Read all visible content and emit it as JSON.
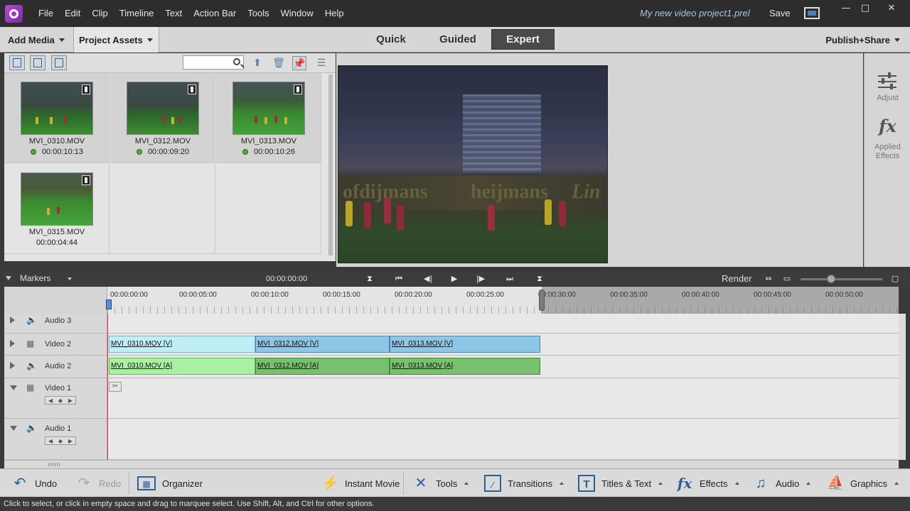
{
  "titlebar": {
    "menu": [
      "File",
      "Edit",
      "Clip",
      "Timeline",
      "Text",
      "Action Bar",
      "Tools",
      "Window",
      "Help"
    ],
    "project_name": "My new video project1.prel",
    "save_label": "Save",
    "min_glyph": "—",
    "max_glyph": "□",
    "close_glyph": "✕"
  },
  "modebar": {
    "add_media": "Add Media",
    "project_assets": "Project Assets",
    "tabs": [
      "Quick",
      "Guided",
      "Expert"
    ],
    "active_tab": "Expert",
    "publish_share": "Publish+Share"
  },
  "assets": {
    "search_placeholder": "",
    "items": [
      {
        "name": "MVI_0310.MOV",
        "duration": "00:00:10:13",
        "used": true
      },
      {
        "name": "MVI_0312.MOV",
        "duration": "00:00:09:20",
        "used": true
      },
      {
        "name": "MVI_0313.MOV",
        "duration": "00:00:10:26",
        "used": true
      },
      {
        "name": "MVI_0315.MOV",
        "duration": "00:00:04:44",
        "used": false
      }
    ]
  },
  "monitor": {
    "brand_1": "ofdijmans",
    "brand_2": "heijmans",
    "brand_3": "Lin"
  },
  "right_panel": {
    "adjust": "Adjust",
    "fx_glyph": "fx",
    "applied_effects_1": "Applied",
    "applied_effects_2": "Effects"
  },
  "timeline": {
    "markers_label": "Markers",
    "timecode": "00:00:00:00",
    "render_label": "Render",
    "ruler_labels": [
      "00:00:00:00",
      "00:00:05:00",
      "00:00:10:00",
      "00:00:15:00",
      "00:00:20:00",
      "00:00:25:00",
      "00:00:30:00",
      "00:00:35:00",
      "00:00:40:00",
      "00:00:45:00",
      "00:00:50:00"
    ],
    "tracks": {
      "audio3": "Audio 3",
      "video2": "Video 2",
      "audio2": "Audio 2",
      "video1": "Video 1",
      "audio1": "Audio 1"
    },
    "video_clips": [
      "MVI_0310.MOV [V]",
      "MVI_0312.MOV [V]",
      "MVI_0313.MOV [V]"
    ],
    "audio_clips": [
      "MVI_0310.MOV [A]",
      "MVI_0312.MOV [A]",
      "MVI_0313.MOV [A]"
    ]
  },
  "bottombar": {
    "undo": "Undo",
    "redo": "Redo",
    "organizer": "Organizer",
    "instant_movie": "Instant Movie",
    "tools": "Tools",
    "transitions": "Transitions",
    "titles_text": "Titles & Text",
    "effects": "Effects",
    "audio": "Audio",
    "graphics": "Graphics"
  },
  "status": "Click to select, or click in empty space and drag to marquee select. Use Shift, Alt, and Ctrl for other options.",
  "colors": {
    "video_clip_selected": "#bfeef7",
    "video_clip": "#8ec6e6",
    "audio_clip_selected": "#a9f0a5",
    "audio_clip": "#78bf6e",
    "playhead": "#e53a3a"
  }
}
